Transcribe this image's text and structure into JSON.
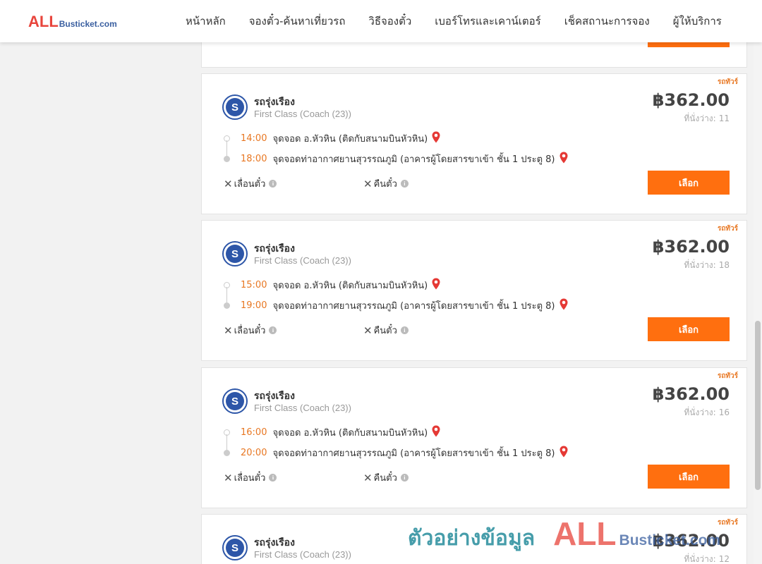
{
  "nav": {
    "logo_all": "ALL",
    "logo_rest": "Busticket.com",
    "items": [
      {
        "label": "หน้าหลัก"
      },
      {
        "label": "จองตั๋ว-ค้นหาเที่ยวรถ"
      },
      {
        "label": "วิธีจองตั๋ว"
      },
      {
        "label": "เบอร์โทรและเคาน์เตอร์"
      },
      {
        "label": "เช็คสถานะการจอง"
      },
      {
        "label": "ผู้ให้บริการ"
      }
    ]
  },
  "trips": [
    {
      "tag": "รถทัวร์",
      "operator": "รถรุ่งเรือง",
      "bus_class": "First Class (Coach (23))",
      "price": "฿362.00",
      "seats_label": "ที่นั่งว่าง:",
      "seats": "11",
      "depart_time": "14:00",
      "depart_place": "จุดจอด อ.หัวหิน (ติดกับสนามบินหัวหิน)",
      "arrive_time": "18:00",
      "arrive_place": "จุดจอดท่าอากาศยานสุวรรณภูมิ (อาคารผู้โดยสารขาเข้า ชั้น 1 ประตู 8)",
      "policy_change": "เลื่อนตั๋ว",
      "policy_refund": "คืนตั๋ว",
      "select_label": "เลือก"
    },
    {
      "tag": "รถทัวร์",
      "operator": "รถรุ่งเรือง",
      "bus_class": "First Class (Coach (23))",
      "price": "฿362.00",
      "seats_label": "ที่นั่งว่าง:",
      "seats": "18",
      "depart_time": "15:00",
      "depart_place": "จุดจอด อ.หัวหิน (ติดกับสนามบินหัวหิน)",
      "arrive_time": "19:00",
      "arrive_place": "จุดจอดท่าอากาศยานสุวรรณภูมิ (อาคารผู้โดยสารขาเข้า ชั้น 1 ประตู 8)",
      "policy_change": "เลื่อนตั๋ว",
      "policy_refund": "คืนตั๋ว",
      "select_label": "เลือก"
    },
    {
      "tag": "รถทัวร์",
      "operator": "รถรุ่งเรือง",
      "bus_class": "First Class (Coach (23))",
      "price": "฿362.00",
      "seats_label": "ที่นั่งว่าง:",
      "seats": "16",
      "depart_time": "16:00",
      "depart_place": "จุดจอด อ.หัวหิน (ติดกับสนามบินหัวหิน)",
      "arrive_time": "20:00",
      "arrive_place": "จุดจอดท่าอากาศยานสุวรรณภูมิ (อาคารผู้โดยสารขาเข้า ชั้น 1 ประตู 8)",
      "policy_change": "เลื่อนตั๋ว",
      "policy_refund": "คืนตั๋ว",
      "select_label": "เลือก"
    },
    {
      "tag": "รถทัวร์",
      "operator": "รถรุ่งเรือง",
      "bus_class": "First Class (Coach (23))",
      "price": "฿362.00",
      "seats_label": "ที่นั่งว่าง:",
      "seats": "12"
    }
  ],
  "watermark": {
    "thai": "ตัวอย่างข้อมูล",
    "all": "ALL",
    "rest": "Busticket.com"
  },
  "icons": {
    "operator_logo": "S",
    "pin": "map-pin-icon",
    "info": "i",
    "close": "✕"
  },
  "colors": {
    "accent": "#ff6f0f",
    "time": "#e87722",
    "brand_red": "#e8453c",
    "brand_blue": "#3a5fa0"
  }
}
